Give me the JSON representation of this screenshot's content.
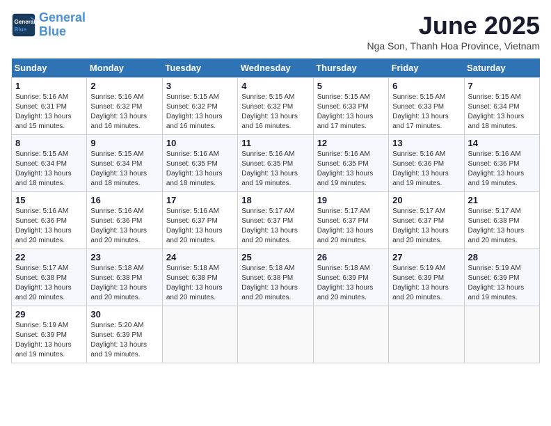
{
  "logo": {
    "line1": "General",
    "line2": "Blue"
  },
  "title": "June 2025",
  "subtitle": "Nga Son, Thanh Hoa Province, Vietnam",
  "days_of_week": [
    "Sunday",
    "Monday",
    "Tuesday",
    "Wednesday",
    "Thursday",
    "Friday",
    "Saturday"
  ],
  "weeks": [
    [
      {
        "day": 1,
        "details": "Sunrise: 5:16 AM\nSunset: 6:31 PM\nDaylight: 13 hours\nand 15 minutes."
      },
      {
        "day": 2,
        "details": "Sunrise: 5:16 AM\nSunset: 6:32 PM\nDaylight: 13 hours\nand 16 minutes."
      },
      {
        "day": 3,
        "details": "Sunrise: 5:15 AM\nSunset: 6:32 PM\nDaylight: 13 hours\nand 16 minutes."
      },
      {
        "day": 4,
        "details": "Sunrise: 5:15 AM\nSunset: 6:32 PM\nDaylight: 13 hours\nand 16 minutes."
      },
      {
        "day": 5,
        "details": "Sunrise: 5:15 AM\nSunset: 6:33 PM\nDaylight: 13 hours\nand 17 minutes."
      },
      {
        "day": 6,
        "details": "Sunrise: 5:15 AM\nSunset: 6:33 PM\nDaylight: 13 hours\nand 17 minutes."
      },
      {
        "day": 7,
        "details": "Sunrise: 5:15 AM\nSunset: 6:34 PM\nDaylight: 13 hours\nand 18 minutes."
      }
    ],
    [
      {
        "day": 8,
        "details": "Sunrise: 5:15 AM\nSunset: 6:34 PM\nDaylight: 13 hours\nand 18 minutes."
      },
      {
        "day": 9,
        "details": "Sunrise: 5:15 AM\nSunset: 6:34 PM\nDaylight: 13 hours\nand 18 minutes."
      },
      {
        "day": 10,
        "details": "Sunrise: 5:16 AM\nSunset: 6:35 PM\nDaylight: 13 hours\nand 18 minutes."
      },
      {
        "day": 11,
        "details": "Sunrise: 5:16 AM\nSunset: 6:35 PM\nDaylight: 13 hours\nand 19 minutes."
      },
      {
        "day": 12,
        "details": "Sunrise: 5:16 AM\nSunset: 6:35 PM\nDaylight: 13 hours\nand 19 minutes."
      },
      {
        "day": 13,
        "details": "Sunrise: 5:16 AM\nSunset: 6:36 PM\nDaylight: 13 hours\nand 19 minutes."
      },
      {
        "day": 14,
        "details": "Sunrise: 5:16 AM\nSunset: 6:36 PM\nDaylight: 13 hours\nand 19 minutes."
      }
    ],
    [
      {
        "day": 15,
        "details": "Sunrise: 5:16 AM\nSunset: 6:36 PM\nDaylight: 13 hours\nand 20 minutes."
      },
      {
        "day": 16,
        "details": "Sunrise: 5:16 AM\nSunset: 6:36 PM\nDaylight: 13 hours\nand 20 minutes."
      },
      {
        "day": 17,
        "details": "Sunrise: 5:16 AM\nSunset: 6:37 PM\nDaylight: 13 hours\nand 20 minutes."
      },
      {
        "day": 18,
        "details": "Sunrise: 5:17 AM\nSunset: 6:37 PM\nDaylight: 13 hours\nand 20 minutes."
      },
      {
        "day": 19,
        "details": "Sunrise: 5:17 AM\nSunset: 6:37 PM\nDaylight: 13 hours\nand 20 minutes."
      },
      {
        "day": 20,
        "details": "Sunrise: 5:17 AM\nSunset: 6:37 PM\nDaylight: 13 hours\nand 20 minutes."
      },
      {
        "day": 21,
        "details": "Sunrise: 5:17 AM\nSunset: 6:38 PM\nDaylight: 13 hours\nand 20 minutes."
      }
    ],
    [
      {
        "day": 22,
        "details": "Sunrise: 5:17 AM\nSunset: 6:38 PM\nDaylight: 13 hours\nand 20 minutes."
      },
      {
        "day": 23,
        "details": "Sunrise: 5:18 AM\nSunset: 6:38 PM\nDaylight: 13 hours\nand 20 minutes."
      },
      {
        "day": 24,
        "details": "Sunrise: 5:18 AM\nSunset: 6:38 PM\nDaylight: 13 hours\nand 20 minutes."
      },
      {
        "day": 25,
        "details": "Sunrise: 5:18 AM\nSunset: 6:38 PM\nDaylight: 13 hours\nand 20 minutes."
      },
      {
        "day": 26,
        "details": "Sunrise: 5:18 AM\nSunset: 6:39 PM\nDaylight: 13 hours\nand 20 minutes."
      },
      {
        "day": 27,
        "details": "Sunrise: 5:19 AM\nSunset: 6:39 PM\nDaylight: 13 hours\nand 20 minutes."
      },
      {
        "day": 28,
        "details": "Sunrise: 5:19 AM\nSunset: 6:39 PM\nDaylight: 13 hours\nand 19 minutes."
      }
    ],
    [
      {
        "day": 29,
        "details": "Sunrise: 5:19 AM\nSunset: 6:39 PM\nDaylight: 13 hours\nand 19 minutes."
      },
      {
        "day": 30,
        "details": "Sunrise: 5:20 AM\nSunset: 6:39 PM\nDaylight: 13 hours\nand 19 minutes."
      },
      null,
      null,
      null,
      null,
      null
    ]
  ]
}
